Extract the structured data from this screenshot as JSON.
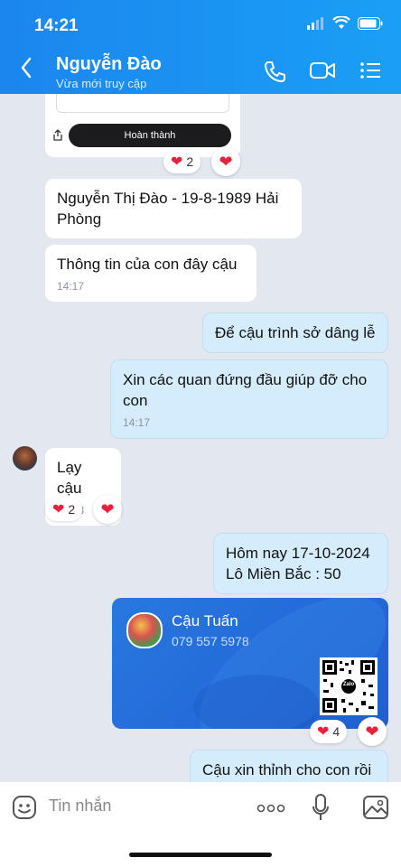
{
  "status": {
    "time": "14:21"
  },
  "header": {
    "title": "Nguyễn Đào",
    "subtitle": "Vừa mới truy cập",
    "back_icon": "chevron-left-icon",
    "call_icon": "phone-icon",
    "video_icon": "video-icon",
    "menu_icon": "list-icon"
  },
  "messages": {
    "shared_image_button": "Hoàn thành",
    "shared_image_reaction_count": "2",
    "m1_text": "Nguyễn Thị Đào - 19-8-1989 Hải Phòng",
    "m2_text": "Thông  tin của con đây cậu",
    "m2_time": "14:17",
    "m3_text": "Để cậu trình sở dâng lễ",
    "m4_text": "Xin các quan đứng đầu giúp đỡ cho con",
    "m4_time": "14:17",
    "m5_text": "Lạy cậu",
    "m5_time": "14:18",
    "m5_reaction_count": "2",
    "m6_line1": "Hôm nay 17-10-2024",
    "m6_line2": "Lô Miền Bắc : 50",
    "contact_name": "Cậu Tuấn",
    "contact_phone": "079 557 5978",
    "contact_qr_label": "Zalo",
    "contact_reaction_count": "4",
    "m7_text": "Cậu xin thỉnh cho con rồi"
  },
  "input": {
    "placeholder": "Tin nhắn",
    "emoji_icon": "sticker-icon",
    "more_icon": "more-icon",
    "mic_icon": "mic-icon",
    "image_icon": "image-icon"
  },
  "colors": {
    "header": "#1a8ff2",
    "sent_bubble": "#d5ecfd",
    "received_bubble": "#ffffff",
    "heart": "#e8213c",
    "card": "#2370db"
  }
}
